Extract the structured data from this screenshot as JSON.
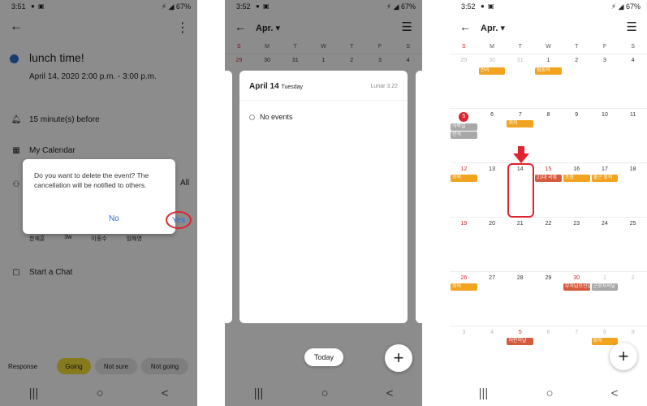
{
  "panel1": {
    "status": {
      "time": "3:51",
      "battery": "67%"
    },
    "event_title": "lunch time!",
    "event_date": "April 14, 2020  2:00 p.m. - 3:00 p.m.",
    "reminder": "15 minute(s) before",
    "calendar": "My Calendar",
    "side_text": "All",
    "people": [
      "한재훈",
      "3w",
      "이종수",
      "임해영"
    ],
    "chat": "Start a Chat",
    "dialog": {
      "message": "Do you want to delete the event? The cancellation will be notified to others.",
      "no": "No",
      "yes": "Yes"
    },
    "response": {
      "label": "Response",
      "going": "Going",
      "not_sure": "Not sure",
      "not_going": "Not going"
    },
    "accent": "#2b6fd6"
  },
  "panel2": {
    "status": {
      "time": "3:52",
      "battery": "67%"
    },
    "month": "Apr.",
    "dow": [
      "S",
      "M",
      "T",
      "W",
      "T",
      "F",
      "S"
    ],
    "first_row": [
      "29",
      "30",
      "31",
      "1",
      "2",
      "3",
      "4"
    ],
    "card": {
      "date": "April 14",
      "weekday": "Tuesday",
      "lunar": "Lunar 3.22",
      "empty": "No events"
    },
    "today_button": "Today"
  },
  "panel3": {
    "status": {
      "time": "3:52",
      "battery": "67%"
    },
    "month": "Apr.",
    "dow": [
      "S",
      "M",
      "T",
      "W",
      "T",
      "F",
      "S"
    ],
    "weeks": [
      [
        "29",
        "30",
        "31",
        "1",
        "2",
        "3",
        "4"
      ],
      [
        "5",
        "6",
        "7",
        "8",
        "9",
        "10",
        "11"
      ],
      [
        "12",
        "13",
        "14",
        "15",
        "16",
        "17",
        "18"
      ],
      [
        "19",
        "20",
        "21",
        "22",
        "23",
        "24",
        "25"
      ],
      [
        "26",
        "27",
        "28",
        "29",
        "30",
        "1",
        "2"
      ],
      [
        "3",
        "4",
        "5",
        "6",
        "7",
        "8",
        "9"
      ]
    ],
    "events": {
      "w0_mon": "권리 ",
      "w0_wed": "팀회의",
      "w1_sun_a": "식목일",
      "w1_sun_b": "한식",
      "w1_tue": "회의",
      "w1_fri": "",
      "w2_sun": "회의",
      "w2_wed": "21대 국회",
      "w2_thu": "조회",
      "w2_fri": "출근 회의",
      "w4_sun": "회의",
      "w4_thu": "부처님오신날",
      "w4_fri": "근로자의날",
      "w5_tue": "어린이날",
      "w5_fri": "회의"
    },
    "highlight_date": "14"
  },
  "nav": {
    "recent": "|||",
    "home": "○",
    "back": "<"
  }
}
